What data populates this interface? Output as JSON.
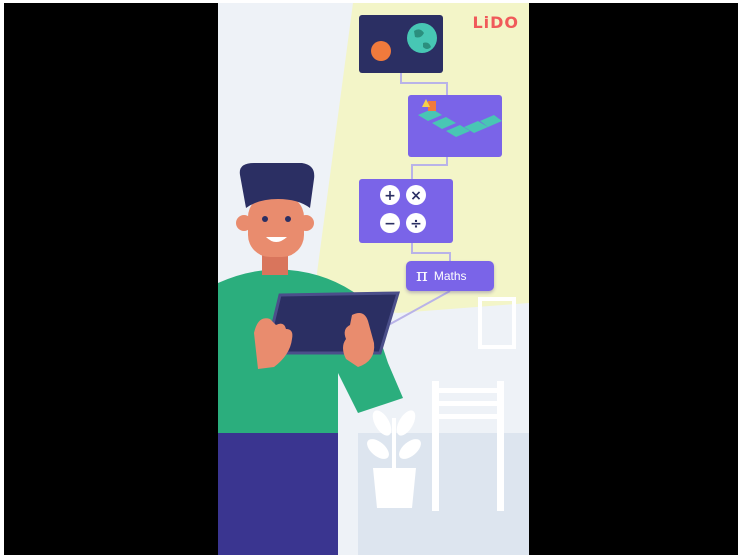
{
  "brand": {
    "logo_text": "LiDO",
    "logo_color": "#f05a5a"
  },
  "maths_chip": {
    "symbol": "π",
    "label": "Maths",
    "background": "#7a64e8"
  },
  "cards": [
    {
      "name": "planet-card",
      "icon": "globe-icon"
    },
    {
      "name": "board-game-card",
      "icon": "game-board-icon"
    },
    {
      "name": "arithmetic-card",
      "icon": "math-operators-icon"
    }
  ],
  "arithmetic_symbols": [
    "+",
    "×",
    "−",
    "÷"
  ],
  "colors": {
    "letterbox": "#000000",
    "scene_background": "#eef2f7",
    "highlight_beam": "#f3f5c8",
    "card_purple": "#7a64e8",
    "card_navy": "#2b2f63",
    "shirt_green": "#2bae7d",
    "pants_blue": "#3a3590",
    "skin": "#e98c6e"
  }
}
